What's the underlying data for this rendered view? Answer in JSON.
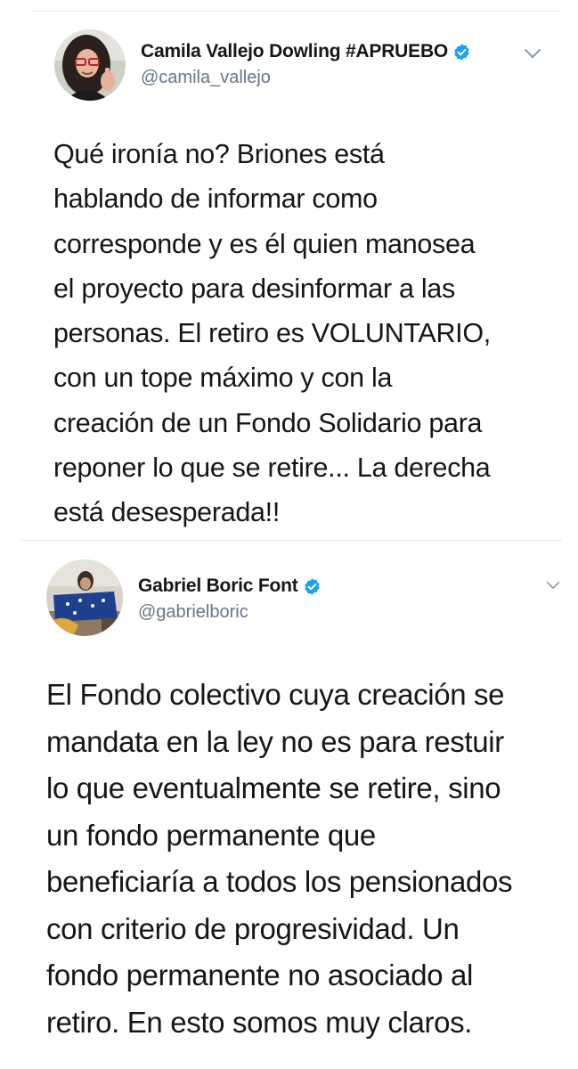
{
  "tweets": [
    {
      "display_name": "Camila Vallejo Dowling #APRUEBO",
      "handle": "@camila_vallejo",
      "verified": true,
      "avatar": "profile-photo",
      "text": "Qué ironía no? Briones está\nhablando de informar como\ncorresponde y es él quien manosea\nel proyecto para desinformar a las\npersonas. El retiro es VOLUNTARIO,\ncon un tope máximo y con la\ncreación de un Fondo Solidario para\nreponer lo que se retire... La derecha\nestá desesperada!!"
    },
    {
      "display_name": "Gabriel Boric Font",
      "handle": "@gabrielboric",
      "verified": true,
      "avatar": "profile-photo",
      "text": "El Fondo colectivo cuya creación se\nmandata en la ley no es para restuir\nlo que eventualmente se retire, sino\nun fondo permanente que\nbeneficiaría a todos los pensionados\ncon criterio de progresividad. Un\nfondo permanente no asociado al\nretiro. En esto somos muy claros."
    }
  ],
  "icons": {
    "verified": "verified-badge-icon",
    "menu": "chevron-down-icon"
  },
  "colors": {
    "verified": "#1da1f2",
    "text": "#14171a",
    "secondary": "#657786",
    "divider": "#e6ecf0"
  }
}
